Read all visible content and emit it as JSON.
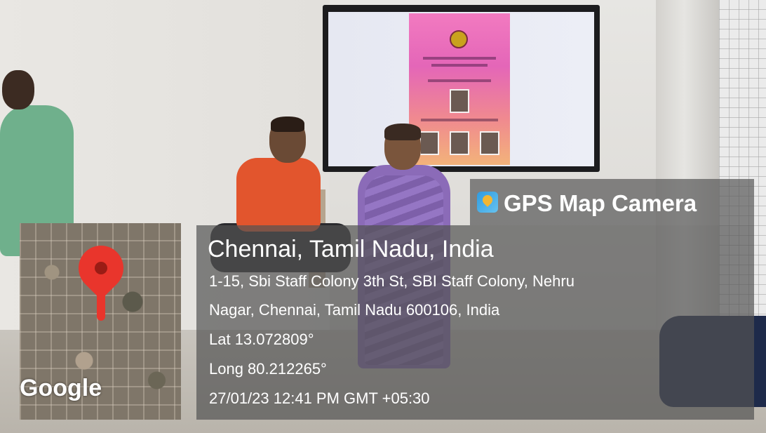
{
  "overlay": {
    "app_title": "GPS Map Camera",
    "app_icon": "gps-map-camera-app-icon",
    "map_logo": "Google",
    "map_pin_icon": "location-pin-icon",
    "pin_color": "#e9352c",
    "city": "Chennai, Tamil Nadu, India",
    "address_line1": "1-15, Sbi Staff Colony 3th St, SBI Staff Colony, Nehru",
    "address_line2": "Nagar, Chennai, Tamil Nadu 600106, India",
    "latitude": "Lat 13.072809°",
    "longitude": "Long 80.212265°",
    "timestamp": "27/01/23 12:41 PM GMT +05:30"
  }
}
